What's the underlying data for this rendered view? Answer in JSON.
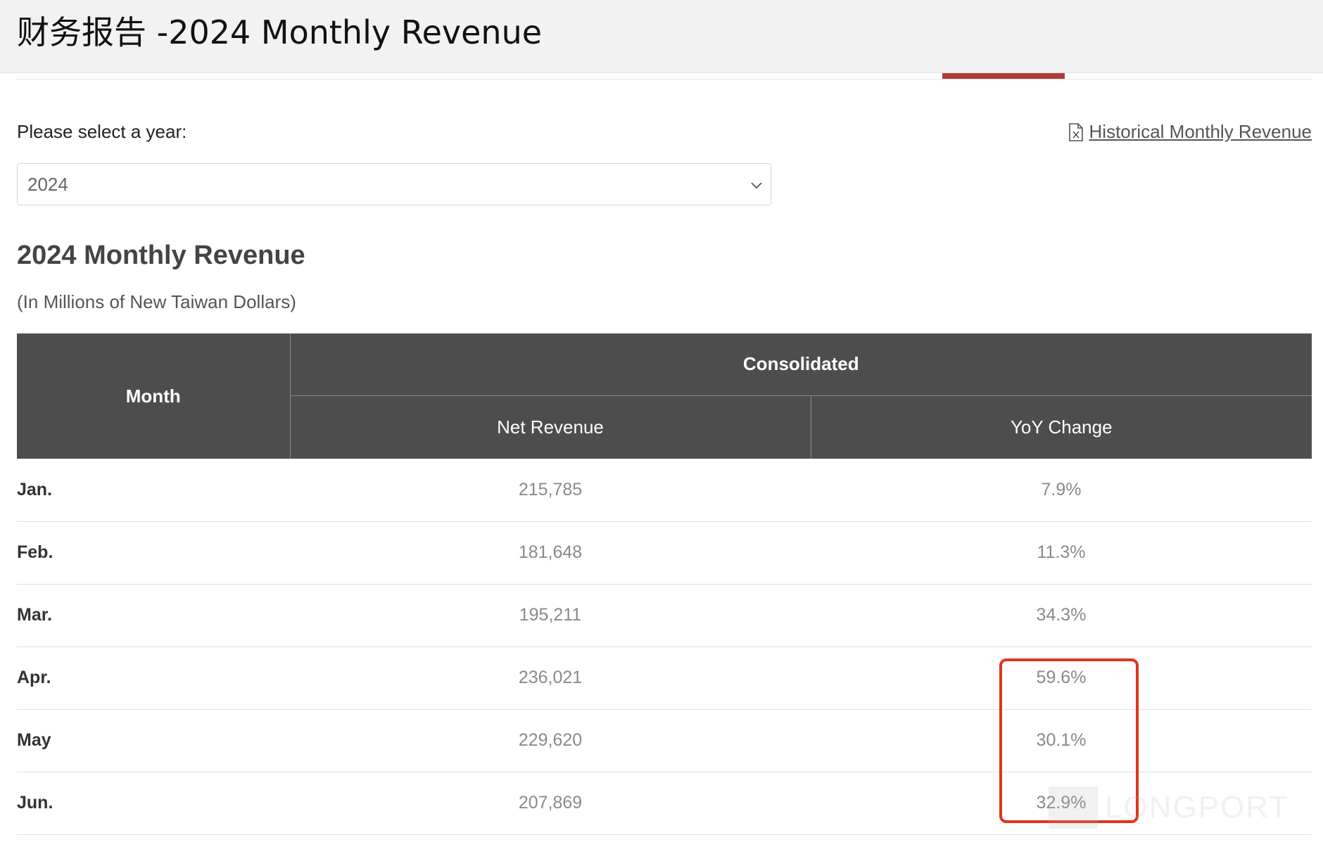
{
  "header": {
    "title": "财务报告 -2024 Monthly Revenue"
  },
  "year_selector": {
    "label": "Please select a year:",
    "selected": "2024"
  },
  "links": {
    "historical": "Historical Monthly Revenue"
  },
  "section": {
    "title": "2024 Monthly Revenue",
    "subtitle": "(In Millions of New Taiwan Dollars)"
  },
  "table": {
    "headers": {
      "month": "Month",
      "consolidated": "Consolidated",
      "net_revenue": "Net Revenue",
      "yoy_change": "YoY Change"
    },
    "rows": [
      {
        "month": "Jan.",
        "net_revenue": "215,785",
        "yoy": "7.9%"
      },
      {
        "month": "Feb.",
        "net_revenue": "181,648",
        "yoy": "11.3%"
      },
      {
        "month": "Mar.",
        "net_revenue": "195,211",
        "yoy": "34.3%"
      },
      {
        "month": "Apr.",
        "net_revenue": "236,021",
        "yoy": "59.6%"
      },
      {
        "month": "May",
        "net_revenue": "229,620",
        "yoy": "30.1%"
      },
      {
        "month": "Jun.",
        "net_revenue": "207,869",
        "yoy": "32.9%"
      }
    ]
  },
  "watermark": {
    "text": "LONGPORT"
  },
  "colors": {
    "accent": "#b3393a",
    "highlight": "#e1341e",
    "header_bg": "#4d4d4d"
  }
}
